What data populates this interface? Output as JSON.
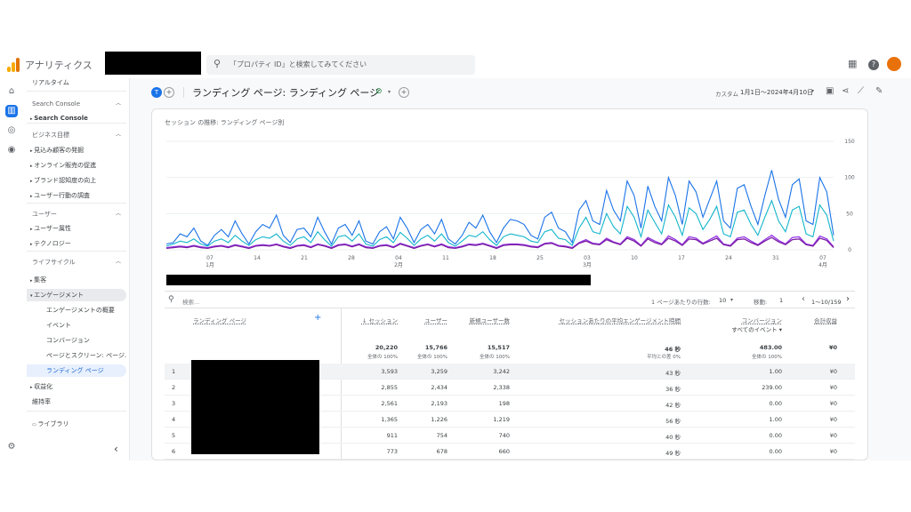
{
  "header": {
    "app_name": "アナリティクス",
    "search_placeholder": "「プロパティ ID」と検索してみてください"
  },
  "nav": {
    "items": [
      {
        "label": "リアルタイム",
        "kind": "plain"
      },
      {
        "label": "Search Console",
        "kind": "section"
      },
      {
        "label": "Search Console",
        "kind": "bullet-bold"
      },
      {
        "label": "ビジネス目標",
        "kind": "section"
      },
      {
        "label": "見込み顧客の発掘",
        "kind": "bullet"
      },
      {
        "label": "オンライン販売の促進",
        "kind": "bullet"
      },
      {
        "label": "ブランド認知度の向上",
        "kind": "bullet"
      },
      {
        "label": "ユーザー行動の調査",
        "kind": "bullet"
      },
      {
        "label": "ユーザー",
        "kind": "section"
      },
      {
        "label": "ユーザー属性",
        "kind": "bullet"
      },
      {
        "label": "テクノロジー",
        "kind": "bullet"
      },
      {
        "label": "ライフサイクル",
        "kind": "section"
      },
      {
        "label": "集客",
        "kind": "bullet"
      },
      {
        "label": "エンゲージメント",
        "kind": "open"
      },
      {
        "label": "エンゲージメントの概要",
        "kind": "sub"
      },
      {
        "label": "イベント",
        "kind": "sub"
      },
      {
        "label": "コンバージョン",
        "kind": "sub"
      },
      {
        "label": "ページとスクリーン: ページ...",
        "kind": "sub"
      },
      {
        "label": "ランディング ページ",
        "kind": "sub-selected"
      },
      {
        "label": "収益化",
        "kind": "bullet"
      },
      {
        "label": "維持率",
        "kind": "plain"
      },
      {
        "label": "ライブラリ",
        "kind": "library"
      }
    ]
  },
  "report": {
    "title": "ランディング ページ: ランディング ページ",
    "date_label": "カスタム",
    "date_range": "1月1日～2024年4月10日",
    "chart_title": "セッション の推移: ランディング ページ別",
    "search_placeholder": "検索...",
    "rows_per_page_label": "1 ページあたりの行数:",
    "rows_per_page": "10",
    "goto_label": "移動:",
    "goto_value": "1",
    "pagination": "1～10/159"
  },
  "chart_data": {
    "type": "line",
    "ylim": [
      0,
      150
    ],
    "yticks": [
      "150",
      "100",
      "50",
      "0"
    ],
    "xticks": [
      {
        "d": "07",
        "m": "1月"
      },
      {
        "d": "14",
        "m": ""
      },
      {
        "d": "21",
        "m": ""
      },
      {
        "d": "28",
        "m": ""
      },
      {
        "d": "04",
        "m": "2月"
      },
      {
        "d": "11",
        "m": ""
      },
      {
        "d": "18",
        "m": ""
      },
      {
        "d": "25",
        "m": ""
      },
      {
        "d": "03",
        "m": "3月"
      },
      {
        "d": "10",
        "m": ""
      },
      {
        "d": "17",
        "m": ""
      },
      {
        "d": "24",
        "m": ""
      },
      {
        "d": "31",
        "m": ""
      },
      {
        "d": "07",
        "m": "4月"
      }
    ],
    "series": [
      {
        "color": "#1a73e8",
        "values": [
          8,
          10,
          22,
          18,
          30,
          12,
          6,
          20,
          28,
          18,
          40,
          22,
          8,
          25,
          35,
          30,
          48,
          20,
          10,
          28,
          30,
          18,
          45,
          25,
          8,
          30,
          35,
          20,
          40,
          12,
          8,
          25,
          32,
          15,
          45,
          30,
          10,
          28,
          35,
          22,
          42,
          15,
          8,
          20,
          38,
          30,
          48,
          25,
          10,
          30,
          42,
          40,
          35,
          20,
          15,
          45,
          52,
          30,
          25,
          10,
          55,
          68,
          40,
          35,
          82,
          55,
          40,
          95,
          75,
          30,
          88,
          60,
          40,
          100,
          75,
          35,
          95,
          80,
          45,
          70,
          95,
          40,
          30,
          85,
          90,
          60,
          35,
          75,
          110,
          70,
          45,
          90,
          98,
          40,
          35,
          100,
          80,
          20
        ]
      },
      {
        "color": "#12b5cb",
        "values": [
          5,
          8,
          12,
          10,
          15,
          8,
          5,
          12,
          15,
          10,
          20,
          12,
          6,
          14,
          18,
          16,
          22,
          12,
          6,
          15,
          18,
          10,
          25,
          14,
          5,
          18,
          20,
          12,
          22,
          8,
          5,
          14,
          18,
          10,
          24,
          16,
          6,
          15,
          20,
          12,
          22,
          10,
          5,
          12,
          20,
          18,
          25,
          14,
          6,
          18,
          22,
          20,
          18,
          12,
          10,
          25,
          28,
          16,
          14,
          6,
          30,
          45,
          25,
          22,
          50,
          32,
          22,
          60,
          45,
          18,
          55,
          38,
          22,
          62,
          45,
          20,
          58,
          50,
          28,
          42,
          60,
          22,
          18,
          52,
          55,
          35,
          20,
          45,
          68,
          40,
          25,
          55,
          60,
          22,
          18,
          62,
          48,
          12
        ]
      },
      {
        "color": "#9334e6",
        "values": [
          3,
          4,
          5,
          4,
          6,
          4,
          3,
          5,
          6,
          4,
          7,
          5,
          3,
          6,
          7,
          6,
          8,
          5,
          3,
          6,
          7,
          4,
          8,
          6,
          3,
          7,
          8,
          5,
          8,
          4,
          3,
          6,
          7,
          4,
          9,
          6,
          3,
          6,
          8,
          5,
          8,
          4,
          3,
          5,
          8,
          7,
          9,
          6,
          3,
          7,
          8,
          8,
          7,
          5,
          4,
          9,
          10,
          6,
          5,
          3,
          10,
          14,
          9,
          8,
          16,
          11,
          8,
          18,
          14,
          6,
          17,
          12,
          8,
          19,
          14,
          7,
          18,
          16,
          9,
          14,
          19,
          8,
          6,
          16,
          18,
          12,
          7,
          14,
          20,
          13,
          8,
          17,
          18,
          8,
          6,
          19,
          15,
          4
        ]
      },
      {
        "color": "#7b1fa2",
        "values": [
          2,
          3,
          4,
          3,
          5,
          3,
          2,
          4,
          5,
          3,
          6,
          4,
          2,
          5,
          6,
          5,
          7,
          4,
          2,
          5,
          6,
          3,
          7,
          5,
          2,
          6,
          7,
          4,
          7,
          3,
          2,
          5,
          6,
          3,
          8,
          5,
          2,
          5,
          7,
          4,
          7,
          3,
          2,
          4,
          7,
          6,
          8,
          5,
          2,
          6,
          7,
          7,
          6,
          4,
          3,
          8,
          9,
          5,
          4,
          2,
          9,
          12,
          8,
          7,
          14,
          10,
          7,
          16,
          12,
          5,
          15,
          10,
          7,
          16,
          12,
          6,
          15,
          14,
          8,
          12,
          16,
          7,
          5,
          14,
          15,
          10,
          6,
          12,
          17,
          11,
          7,
          14,
          15,
          7,
          5,
          16,
          13,
          3
        ]
      }
    ]
  },
  "table": {
    "col_landing": "ランディング ページ",
    "columns": [
      {
        "label": "↓ セッション",
        "total": "20,220",
        "sub": "全体の 100%"
      },
      {
        "label": "ユーザー",
        "total": "15,766",
        "sub": "全体の 100%"
      },
      {
        "label": "新規ユーザー数",
        "total": "15,517",
        "sub": "全体の 100%"
      },
      {
        "label": "セッションあたりの平均エンゲージメント時間",
        "total": "46 秒",
        "sub": "平均との差 0%"
      },
      {
        "label": "コンバージョン",
        "label2": "すべてのイベント ▾",
        "total": "483.00",
        "sub": "全体の 100%"
      },
      {
        "label": "合計収益",
        "total": "¥0",
        "sub": ""
      }
    ],
    "rows": [
      {
        "n": "1",
        "v": [
          "3,593",
          "3,259",
          "3,242",
          "43 秒",
          "1.00",
          "¥0"
        ]
      },
      {
        "n": "2",
        "v": [
          "2,855",
          "2,434",
          "2,338",
          "36 秒",
          "239.00",
          "¥0"
        ]
      },
      {
        "n": "3",
        "v": [
          "2,561",
          "2,193",
          "198",
          "42 秒",
          "0.00",
          "¥0"
        ]
      },
      {
        "n": "4",
        "v": [
          "1,365",
          "1,226",
          "1,219",
          "56 秒",
          "1.00",
          "¥0"
        ]
      },
      {
        "n": "5",
        "v": [
          "911",
          "754",
          "740",
          "40 秒",
          "0.00",
          "¥0"
        ]
      },
      {
        "n": "6",
        "v": [
          "773",
          "678",
          "660",
          "49 秒",
          "0.00",
          "¥0"
        ]
      }
    ]
  }
}
